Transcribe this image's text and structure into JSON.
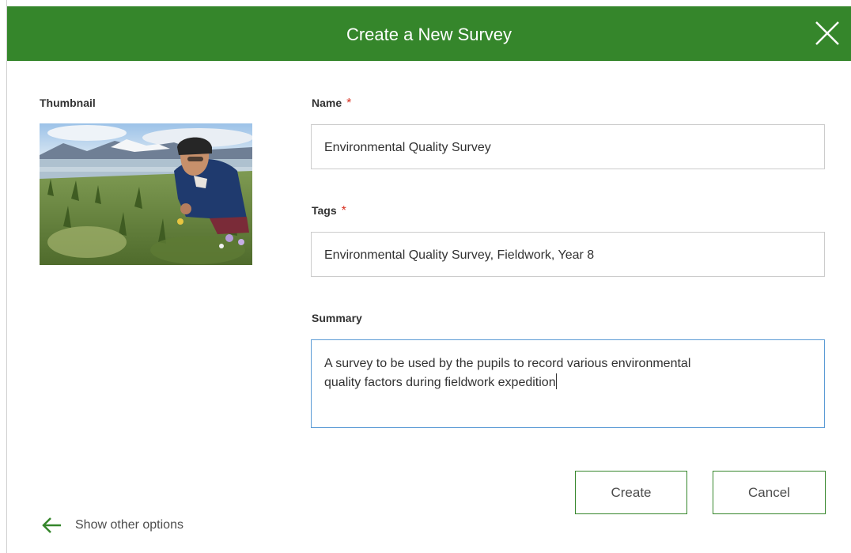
{
  "dialog": {
    "title": "Create a New Survey",
    "close_icon": "close-icon"
  },
  "thumbnail": {
    "label": "Thumbnail"
  },
  "name": {
    "label": "Name",
    "required_mark": "*",
    "value": "Environmental Quality Survey"
  },
  "tags": {
    "label": "Tags",
    "required_mark": "*",
    "value": "Environmental Quality Survey, Fieldwork, Year 8"
  },
  "summary": {
    "label": "Summary",
    "value_line1": "A survey to be used by the pupils to record various environmental",
    "value_line2": "quality factors during fieldwork expedition"
  },
  "buttons": {
    "create": "Create",
    "cancel": "Cancel"
  },
  "footer": {
    "show_other_options": "Show other options",
    "arrow_icon": "arrow-left-icon"
  },
  "colors": {
    "header": "#35862b",
    "required": "#d83020",
    "focus_border": "#5b9bd5"
  }
}
